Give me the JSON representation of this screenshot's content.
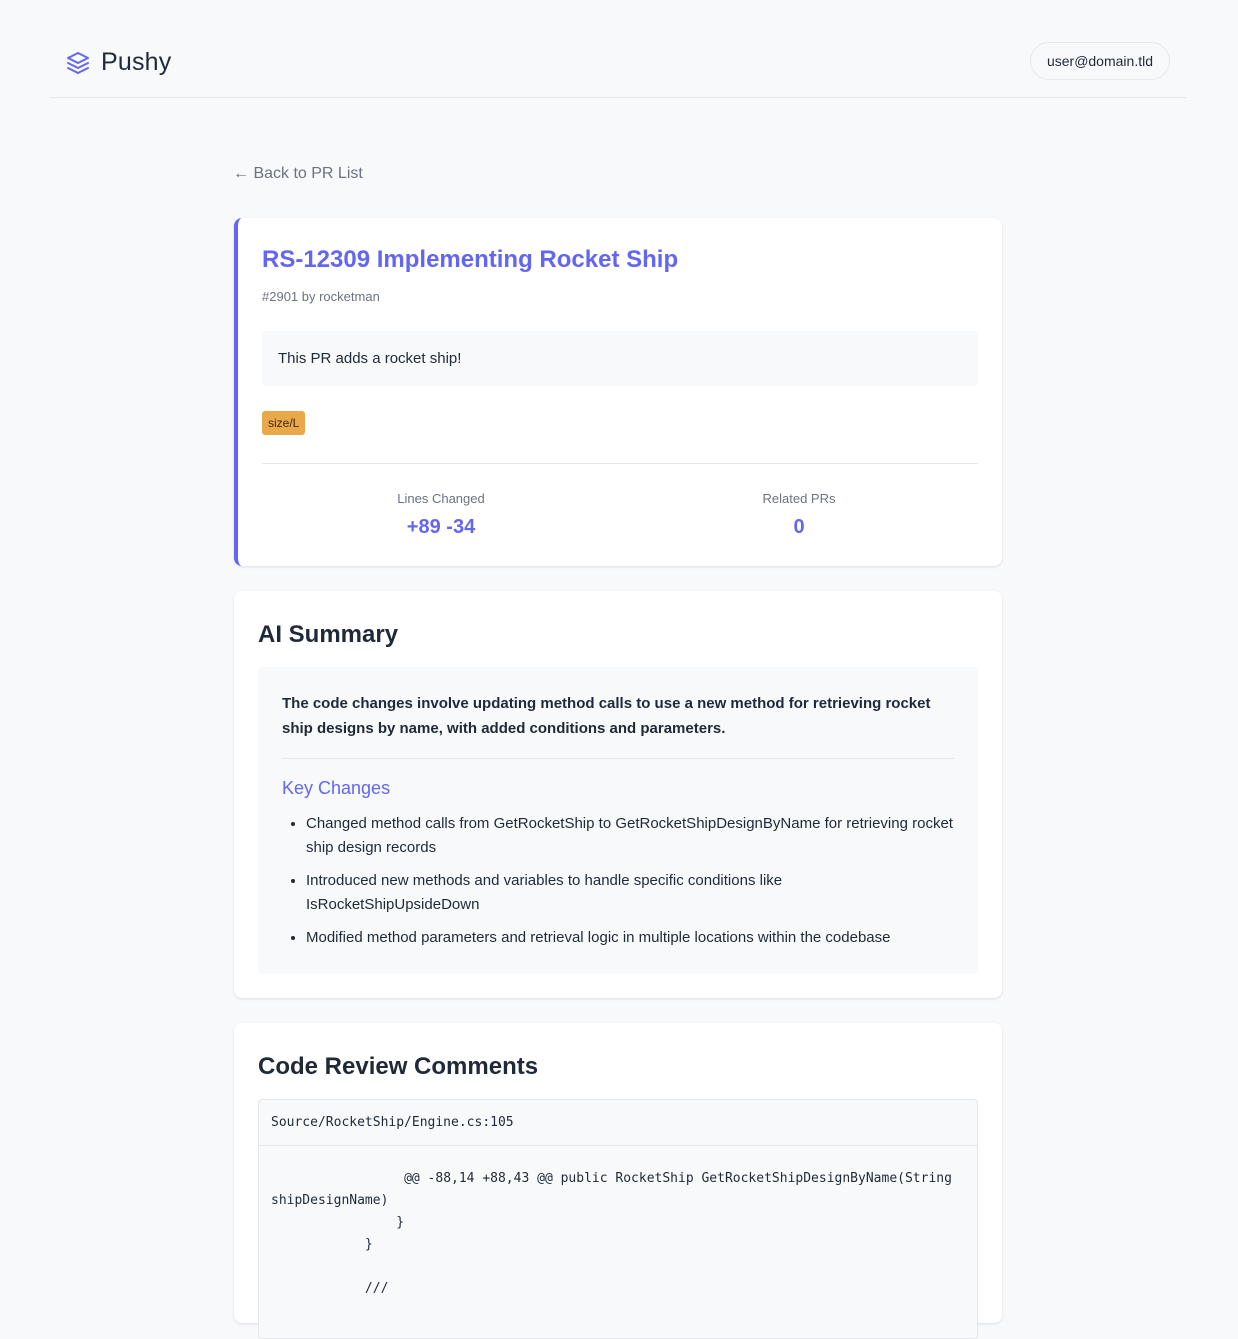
{
  "header": {
    "brand_icon": "layers-icon",
    "brand_name": "Pushy",
    "user_email": "user@domain.tld"
  },
  "nav": {
    "back_label": "← Back to PR List"
  },
  "pr": {
    "title": "RS-12309 Implementing Rocket Ship",
    "meta": "#2901 by rocketman",
    "description": "This PR adds a rocket ship!",
    "labels": [
      "size/L"
    ],
    "stats": [
      {
        "label": "Lines Changed",
        "value": "+89 -34"
      },
      {
        "label": "Related PRs",
        "value": "0"
      }
    ]
  },
  "ai_summary": {
    "title": "AI Summary",
    "summary": "The code changes involve updating method calls to use a new method for retrieving rocket ship designs by name, with added conditions and parameters.",
    "key_changes_title": "Key Changes",
    "key_changes": [
      "Changed method calls from GetRocketShip to GetRocketShipDesignByName for retrieving rocket ship design records",
      "Introduced new methods and variables to handle specific conditions like IsRocketShipUpsideDown",
      "Modified method parameters and retrieval logic in multiple locations within the codebase"
    ]
  },
  "code_review": {
    "title": "Code Review Comments",
    "comments": [
      {
        "file": "Source/RocketShip/Engine.cs:105",
        "diff": "                 @@ -88,14 +88,43 @@ public RocketShip GetRocketShipDesignByName(String shipDesignName)\n                }\n            }\n\n            ///"
      }
    ]
  },
  "colors": {
    "accent": "#6366f1",
    "label_size_l": "#e9a94b",
    "background": "#f8f9fb"
  }
}
